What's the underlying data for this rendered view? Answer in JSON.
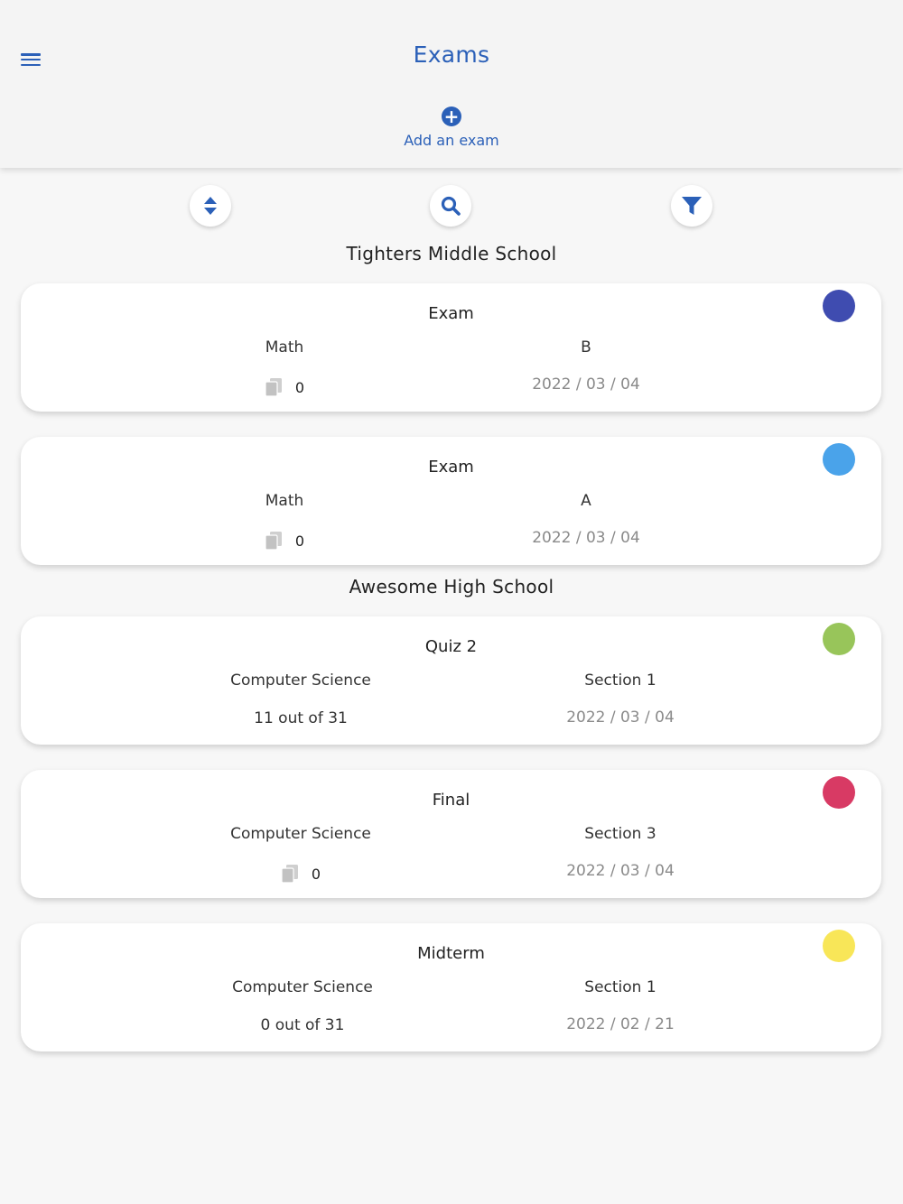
{
  "header": {
    "title": "Exams",
    "add_label": "Add an exam"
  },
  "icons": {
    "menu": "hamburger-menu-icon",
    "add": "plus-circle-icon",
    "sort": "sort-icon",
    "search": "search-icon",
    "filter": "filter-icon",
    "copies": "copy-documents-icon"
  },
  "colors": {
    "accent": "#2b60b8",
    "date_text": "#8a8a8a"
  },
  "groups": [
    {
      "school": "Tighters Middle School",
      "exams": [
        {
          "title": "Exam",
          "subject": "Math",
          "section": "B",
          "status": "0",
          "status_type": "copies",
          "date": "2022 / 03 / 04",
          "color": "#3f4cb0"
        },
        {
          "title": "Exam",
          "subject": "Math",
          "section": "A",
          "status": "0",
          "status_type": "copies",
          "date": "2022 / 03 / 04",
          "color": "#4aa3ea"
        }
      ]
    },
    {
      "school": "Awesome High School",
      "exams": [
        {
          "title": "Quiz 2",
          "subject": "Computer Science",
          "section": "Section 1",
          "status": "11 out of 31",
          "status_type": "text",
          "date": "2022 / 03 / 04",
          "color": "#98c55a"
        },
        {
          "title": "Final",
          "subject": "Computer Science",
          "section": "Section 3",
          "status": "0",
          "status_type": "copies",
          "date": "2022 / 03 / 04",
          "color": "#d83a64"
        },
        {
          "title": "Midterm",
          "subject": "Computer Science",
          "section": "Section 1",
          "status": "0 out of 31",
          "status_type": "text",
          "date": "2022 / 02 / 21",
          "color": "#f8e658"
        }
      ]
    }
  ]
}
